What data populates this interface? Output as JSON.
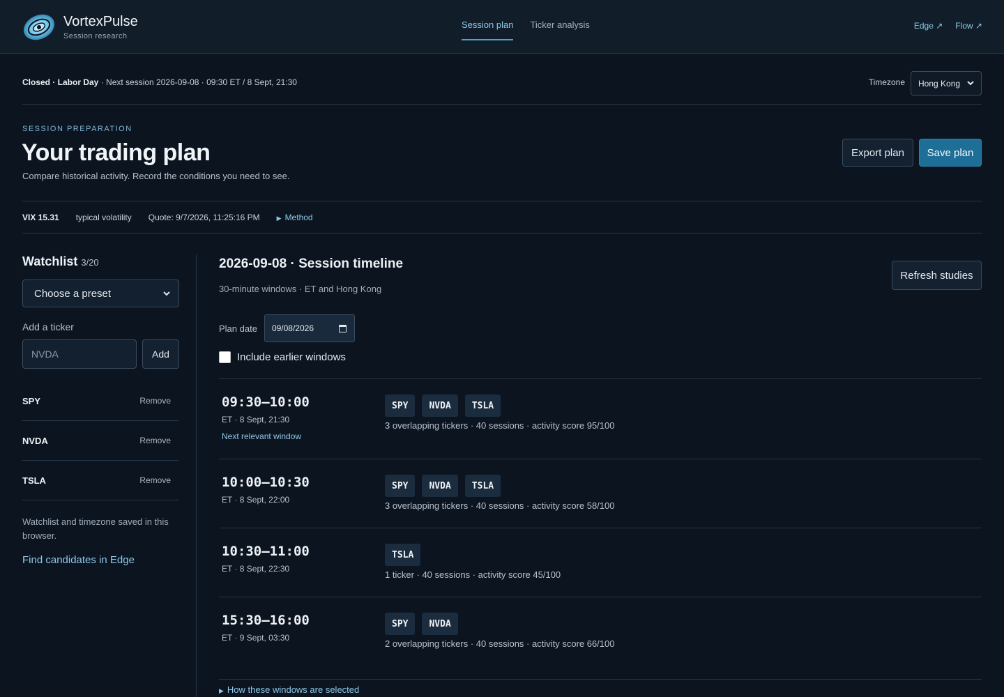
{
  "brand": {
    "name": "VortexPulse",
    "subtitle": "Session research"
  },
  "nav": {
    "tabs": [
      "Session plan",
      "Ticker analysis"
    ],
    "active": 0
  },
  "external_links": [
    "Edge ↗",
    "Flow ↗"
  ],
  "status": {
    "market_state": "Closed · Labor Day",
    "next_session": " · Next session 2026-09-08 · 09:30 ET / 8 Sept, 21:30",
    "timezone_label": "Timezone",
    "timezone_value": "Hong Kong"
  },
  "hero": {
    "eyebrow": "SESSION PREPARATION",
    "title": "Your trading plan",
    "subtitle": "Compare historical activity. Record the conditions you need to see.",
    "export_label": "Export plan",
    "save_label": "Save plan"
  },
  "vix": {
    "value": "VIX 15.31",
    "regime": "typical volatility",
    "quote": "Quote: 9/7/2026, 11:25:16 PM",
    "method": "Method"
  },
  "watchlist": {
    "title": "Watchlist",
    "count": "3/20",
    "preset_placeholder": "Choose a preset",
    "add_label": "Add a ticker",
    "input_placeholder": "NVDA",
    "add_button": "Add",
    "remove_label": "Remove",
    "items": [
      "SPY",
      "NVDA",
      "TSLA"
    ],
    "saved_note": "Watchlist and timezone saved in this browser.",
    "edge_link": "Find candidates in Edge"
  },
  "timeline": {
    "title": "2026-09-08 · Session timeline",
    "subtitle": "30-minute windows · ET and Hong Kong",
    "refresh_label": "Refresh studies",
    "plan_date_label": "Plan date",
    "plan_date_value": "09/08/2026",
    "include_earlier": "Include earlier windows",
    "windows": [
      {
        "time": "09:30–10:00",
        "local": "ET · 8 Sept, 21:30",
        "next": "Next relevant window",
        "tickers": [
          "SPY",
          "NVDA",
          "TSLA"
        ],
        "meta": "3 overlapping tickers · 40 sessions · activity score 95/100"
      },
      {
        "time": "10:00–10:30",
        "local": "ET · 8 Sept, 22:00",
        "next": "",
        "tickers": [
          "SPY",
          "NVDA",
          "TSLA"
        ],
        "meta": "3 overlapping tickers · 40 sessions · activity score 58/100"
      },
      {
        "time": "10:30–11:00",
        "local": "ET · 8 Sept, 22:30",
        "next": "",
        "tickers": [
          "TSLA"
        ],
        "meta": "1 ticker · 40 sessions · activity score 45/100"
      },
      {
        "time": "15:30–16:00",
        "local": "ET · 9 Sept, 03:30",
        "next": "",
        "tickers": [
          "SPY",
          "NVDA"
        ],
        "meta": "2 overlapping tickers · 40 sessions · activity score 66/100"
      }
    ],
    "how_selected": "How these windows are selected"
  }
}
